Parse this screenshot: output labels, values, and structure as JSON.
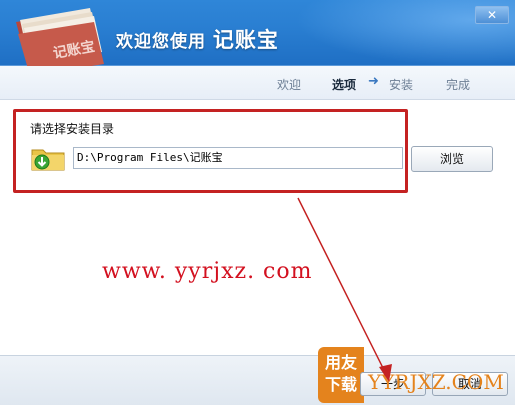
{
  "window": {
    "close_label": "✕"
  },
  "header": {
    "title_prefix": "欢迎您使用",
    "title_brand": "记账宝",
    "logo_text": "记账宝"
  },
  "steps": [
    {
      "label": "欢迎",
      "active": false
    },
    {
      "label": "选项",
      "active": true
    },
    {
      "label": "安装",
      "active": false
    },
    {
      "label": "完成",
      "active": false
    }
  ],
  "step_arrow": "➜",
  "install_dir": {
    "label": "请选择安装目录",
    "path": "D:\\Program Files\\记账宝",
    "browse_label": "浏览"
  },
  "watermark": "www. yyrjxz. com",
  "footer": {
    "next_label": "一步",
    "cancel_label": "取消",
    "logo_text_top": "用友",
    "logo_text_bottom": "下载",
    "site_text": "YYRJXZ.COM"
  },
  "colors": {
    "header_blue": "#2a7fd2",
    "annotation_red": "#c42222",
    "watermark_red": "#d3101f",
    "logo_orange": "#e4831d"
  }
}
